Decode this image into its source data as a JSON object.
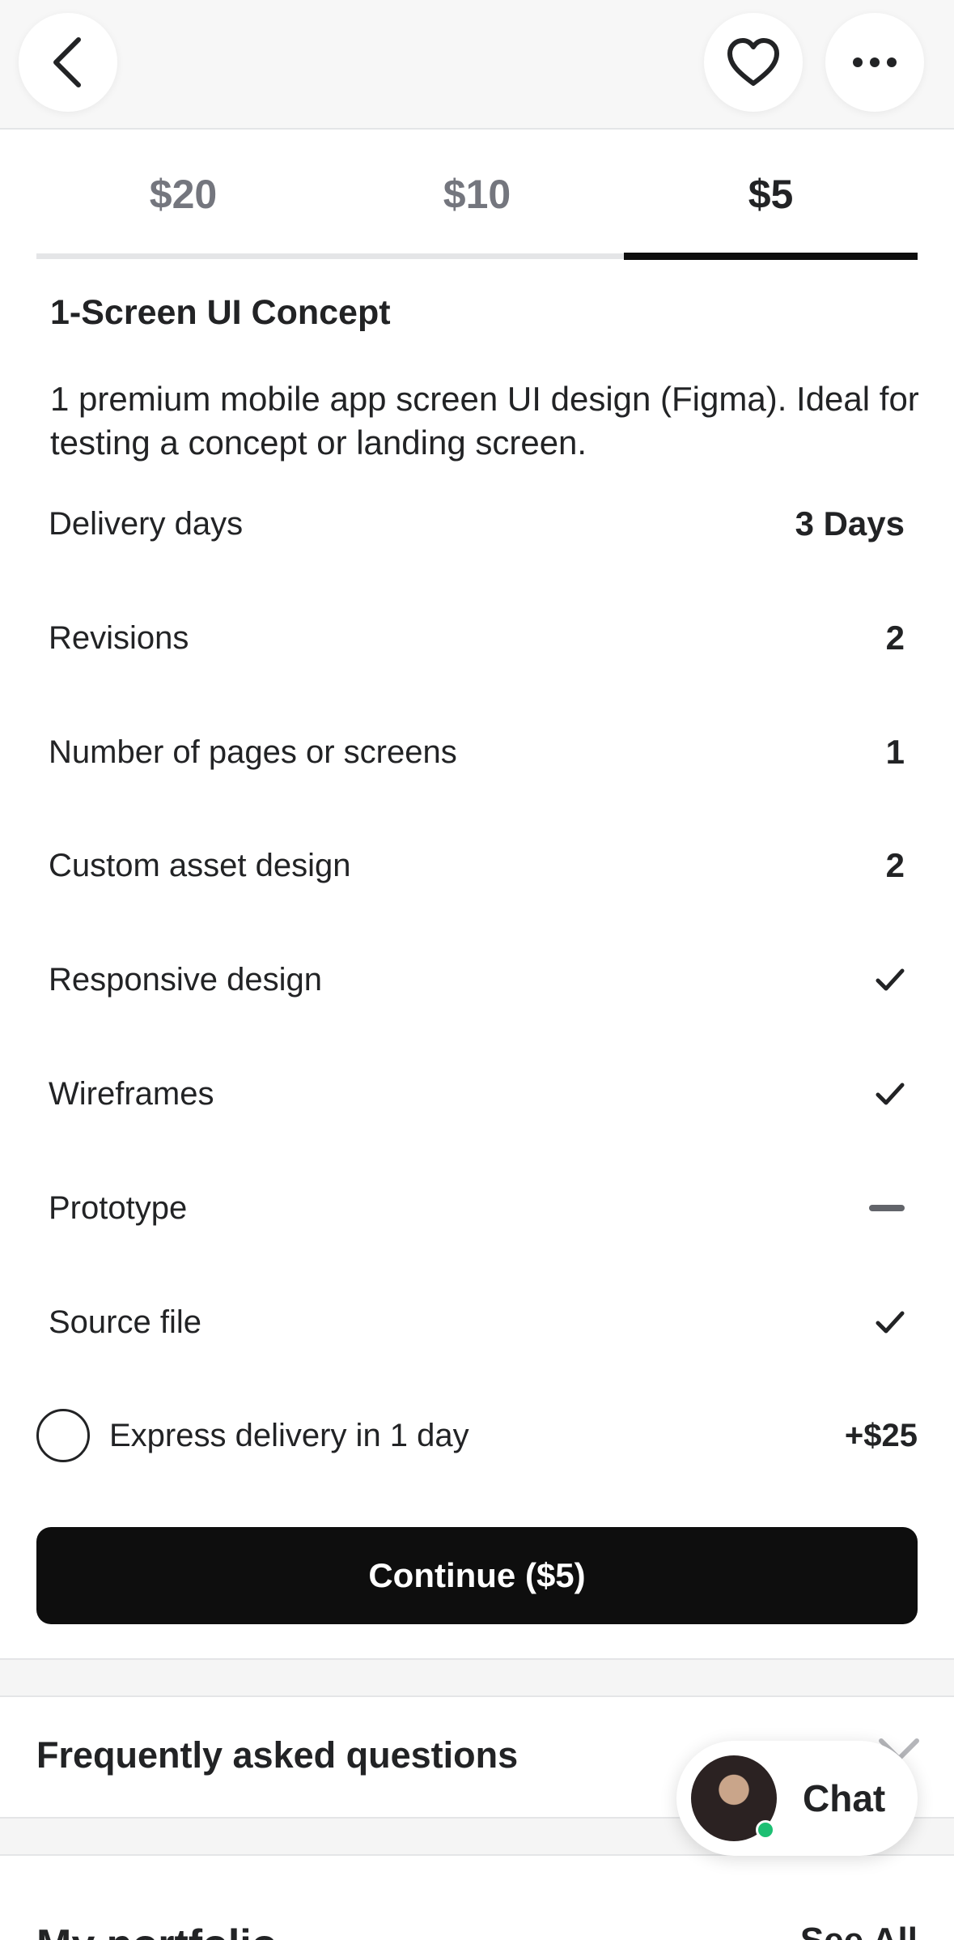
{
  "header": {
    "back_icon": "chevron-left-icon",
    "favorite_icon": "heart-icon",
    "more_icon": "more-horizontal-icon"
  },
  "tabs": [
    {
      "label": "$20",
      "selected": false
    },
    {
      "label": "$10",
      "selected": false
    },
    {
      "label": "$5",
      "selected": true
    }
  ],
  "package": {
    "title": "1-Screen UI Concept",
    "description": "1 premium mobile app screen UI design (Figma). Ideal for testing a concept or landing screen.",
    "features": [
      {
        "label": "Delivery days",
        "value": "3 Days",
        "type": "text"
      },
      {
        "label": "Revisions",
        "value": "2",
        "type": "text"
      },
      {
        "label": "Number of pages or screens",
        "value": "1",
        "type": "text"
      },
      {
        "label": "Custom asset design",
        "value": "2",
        "type": "text"
      },
      {
        "label": "Responsive design",
        "type": "check"
      },
      {
        "label": "Wireframes",
        "type": "check"
      },
      {
        "label": "Prototype",
        "type": "dash"
      },
      {
        "label": "Source file",
        "type": "check"
      }
    ]
  },
  "express": {
    "label": "Express delivery in 1 day",
    "price": "+$25",
    "checked": false
  },
  "continue_label": "Continue ($5)",
  "faq": {
    "title": "Frequently asked questions",
    "chevron_icon": "chevron-down-icon"
  },
  "portfolio": {
    "title": "My portfolio",
    "right": "See All"
  },
  "chat": {
    "label": "Chat",
    "status_color": "#1dbf73"
  },
  "colors": {
    "primary": "#0e0e0e",
    "text": "#222325",
    "muted": "#74767e",
    "online": "#1dbf73"
  }
}
